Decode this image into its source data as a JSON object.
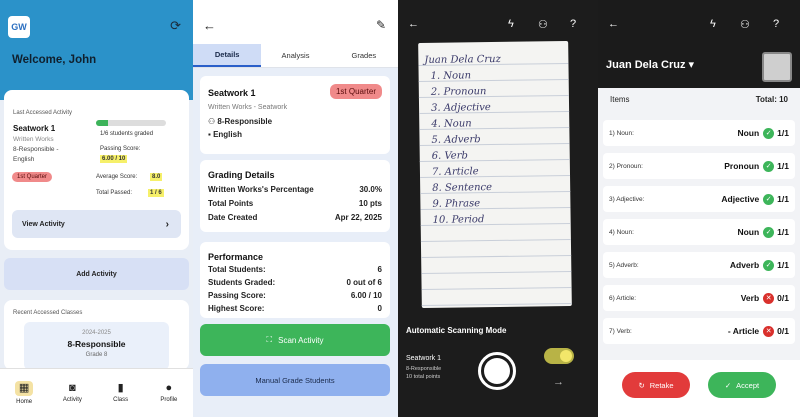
{
  "screen1": {
    "logo_text": "GW",
    "welcome": "Welcome, John",
    "last_accessed_label": "Last Accessed Activity",
    "activity_title": "Seatwork 1",
    "activity_type": "Written Works",
    "activity_class": "8-Responsible -",
    "activity_subject": "English",
    "graded_text": "1/6 students graded",
    "graded_fraction": 0.1667,
    "passing_label": "Passing Score:",
    "passing_value": "6.00 / 10",
    "average_label": "Average Score:",
    "average_value": "8.0",
    "total_passed_label": "Total Passed:",
    "total_passed_value": "1 / 6",
    "quarter_badge": "1st Quarter",
    "view_activity": "View Activity",
    "add_activity": "Add Activity",
    "recent_label": "Recent Accessed Classes",
    "class_year": "2024-2025",
    "class_name": "8-Responsible",
    "class_grade": "Grade 8",
    "nav": [
      {
        "label": "Home",
        "icon": "grid-icon"
      },
      {
        "label": "Activity",
        "icon": "camera-icon"
      },
      {
        "label": "Class",
        "icon": "book-icon"
      },
      {
        "label": "Profile",
        "icon": "person-icon"
      }
    ]
  },
  "screen2": {
    "tabs": [
      "Details",
      "Analysis",
      "Grades"
    ],
    "activity_title": "Seatwork 1",
    "activity_subtitle": "Written Works - Seatwork",
    "class_line": "8-Responsible",
    "subject_line": "English",
    "quarter_badge": "1st Quarter",
    "grading_title": "Grading Details",
    "grading_rows": [
      {
        "label": "Written Works's Percentage",
        "value": "30.0%"
      },
      {
        "label": "Total Points",
        "value": "10 pts"
      },
      {
        "label": "Date Created",
        "value": "Apr 22, 2025"
      }
    ],
    "performance_title": "Performance",
    "performance_rows": [
      {
        "label": "Total Students:",
        "value": "6"
      },
      {
        "label": "Students Graded:",
        "value": "0 out of 6"
      },
      {
        "label": "Passing Score:",
        "value": "6.00 / 10"
      },
      {
        "label": "Highest Score:",
        "value": "0"
      }
    ],
    "scan_button": "Scan Activity",
    "manual_button": "Manual Grade Students"
  },
  "screen3": {
    "paper_lines": [
      "Juan Dela Cruz",
      "1. Noun",
      "2. Pronoun",
      "3. Adjective",
      "4. Noun",
      "5. Adverb",
      "6. Verb",
      "7. Article",
      "8. Sentence",
      "9. Phrase",
      "10. Period"
    ],
    "mode_label": "Automatic Scanning Mode",
    "seatwork": "Seatwork 1",
    "seatwork_class": "8-Responsible",
    "seatwork_points": "10 total points",
    "auto_mode_on": true
  },
  "screen4": {
    "student_name": "Juan Dela Cruz",
    "items_label": "Items",
    "total_label": "Total: 10",
    "items": [
      {
        "q": "1) Noun:",
        "a": "Noun",
        "ok": true,
        "score": "1/1"
      },
      {
        "q": "2) Pronoun:",
        "a": "Pronoun",
        "ok": true,
        "score": "1/1"
      },
      {
        "q": "3) Adjective:",
        "a": "Adjective",
        "ok": true,
        "score": "1/1"
      },
      {
        "q": "4) Noun:",
        "a": "Noun",
        "ok": true,
        "score": "1/1"
      },
      {
        "q": "5) Adverb:",
        "a": "Adverb",
        "ok": true,
        "score": "1/1"
      },
      {
        "q": "6) Article:",
        "a": "Verb",
        "ok": false,
        "score": "0/1"
      },
      {
        "q": "7) Verb:",
        "a": "- Article",
        "ok": false,
        "score": "0/1"
      }
    ],
    "retake_button": "Retake",
    "accept_button": "Accept"
  }
}
